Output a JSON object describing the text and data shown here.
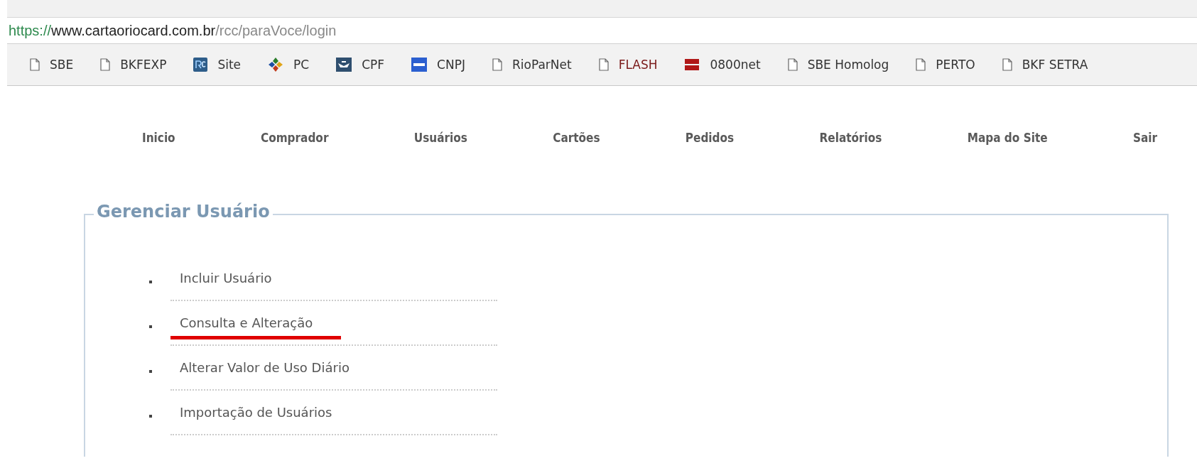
{
  "address_bar": {
    "scheme": "https://",
    "host": "www.cartaoriocard.com.br",
    "path": "/rcc/paraVoce/login"
  },
  "bookmarks": [
    {
      "label": "SBE",
      "kind": "page"
    },
    {
      "label": "BKFEXP",
      "kind": "page"
    },
    {
      "label": "Site",
      "kind": "rc"
    },
    {
      "label": "PC",
      "kind": "puzzle"
    },
    {
      "label": "CPF",
      "kind": "shield"
    },
    {
      "label": "CNPJ",
      "kind": "cnpj"
    },
    {
      "label": "RioParNet",
      "kind": "page"
    },
    {
      "label": "FLASH",
      "kind": "page"
    },
    {
      "label": "0800net",
      "kind": "net"
    },
    {
      "label": "SBE Homolog",
      "kind": "page"
    },
    {
      "label": "PERTO",
      "kind": "page"
    },
    {
      "label": "BKF SETRA",
      "kind": "page"
    }
  ],
  "nav": [
    "Inicio",
    "Comprador",
    "Usuários",
    "Cartões",
    "Pedidos",
    "Relatórios",
    "Mapa do Site",
    "Sair"
  ],
  "panel": {
    "title": "Gerenciar Usuário",
    "items": [
      {
        "label": "Incluir Usuário",
        "underlined": false
      },
      {
        "label": "Consulta e Alteração",
        "underlined": true
      },
      {
        "label": "Alterar Valor de Uso Diário",
        "underlined": false
      },
      {
        "label": "Importação de Usuários",
        "underlined": false
      }
    ]
  }
}
